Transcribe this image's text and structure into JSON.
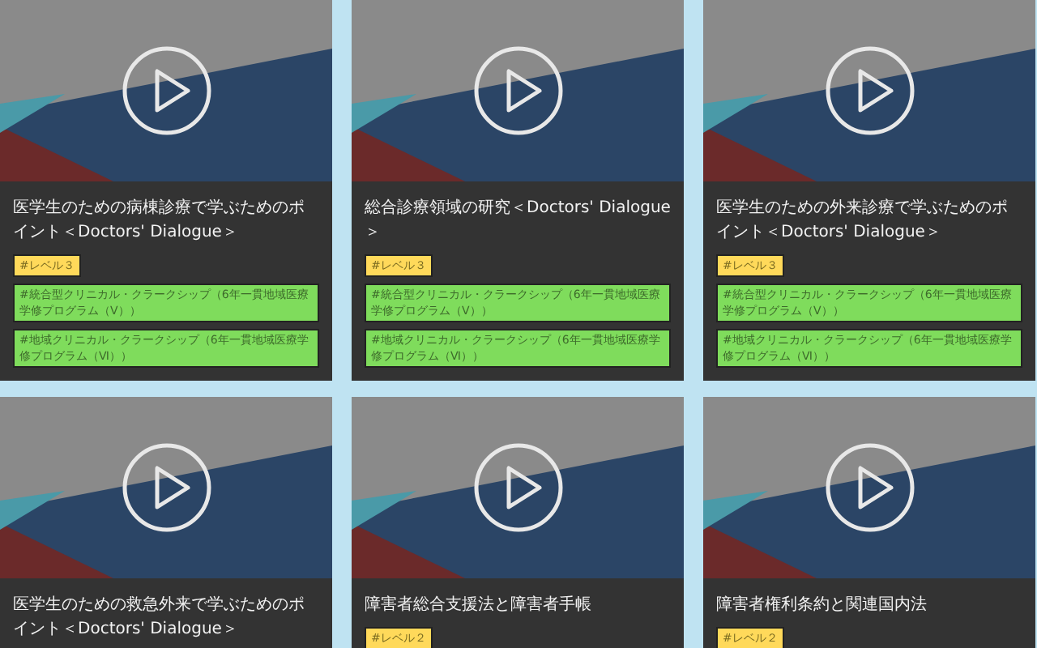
{
  "cards": [
    {
      "title": "医学生のための病棟診療で学ぶためのポイント＜Doctors' Dialogue＞",
      "tags": [
        {
          "kind": "level",
          "text": "#レベル３"
        },
        {
          "kind": "program",
          "text": "#統合型クリニカル・クラークシップ（6年一貫地域医療学修プログラム（Ⅴ））"
        },
        {
          "kind": "program",
          "text": "#地域クリニカル・クラークシップ（6年一貫地域医療学修プログラム（Ⅵ））"
        }
      ]
    },
    {
      "title": "総合診療領域の研究＜Doctors' Dialogue＞",
      "tags": [
        {
          "kind": "level",
          "text": "#レベル３"
        },
        {
          "kind": "program",
          "text": "#統合型クリニカル・クラークシップ（6年一貫地域医療学修プログラム（Ⅴ））"
        },
        {
          "kind": "program",
          "text": "#地域クリニカル・クラークシップ（6年一貫地域医療学修プログラム（Ⅵ））"
        }
      ]
    },
    {
      "title": "医学生のための外来診療で学ぶためのポイント＜Doctors' Dialogue＞",
      "tags": [
        {
          "kind": "level",
          "text": "#レベル３"
        },
        {
          "kind": "program",
          "text": "#統合型クリニカル・クラークシップ（6年一貫地域医療学修プログラム（Ⅴ））"
        },
        {
          "kind": "program",
          "text": "#地域クリニカル・クラークシップ（6年一貫地域医療学修プログラム（Ⅵ））"
        }
      ]
    },
    {
      "title": "医学生のための救急外来で学ぶためのポイント＜Doctors' Dialogue＞"
    },
    {
      "title": "障害者総合支援法と障害者手帳",
      "tags": [
        {
          "kind": "level",
          "text": "#レベル２"
        }
      ]
    },
    {
      "title": "障害者権利条約と関連国内法",
      "tags": [
        {
          "kind": "level",
          "text": "#レベル２"
        }
      ]
    }
  ]
}
